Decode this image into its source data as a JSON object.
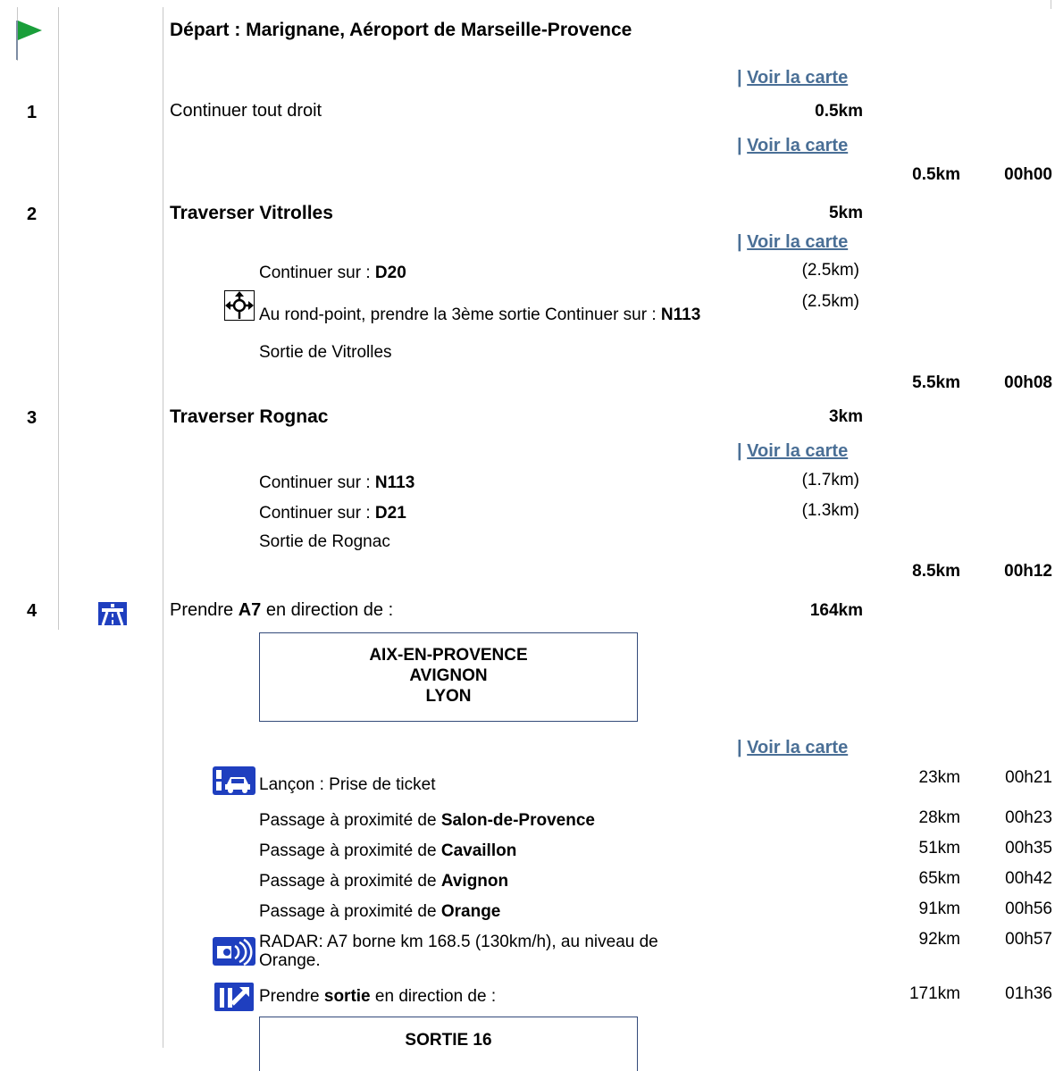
{
  "depart": {
    "label": "Départ : Marignane, Aéroport de Marseille-Provence"
  },
  "map_link": {
    "pipe": "|",
    "label": "Voir la carte"
  },
  "steps": [
    {
      "number": "1",
      "instruction": "Continuer tout droit",
      "distance": "0.5km",
      "cumulative_distance": "0.5km",
      "cumulative_time": "00h00"
    },
    {
      "number": "2",
      "title": "Traverser Vitrolles",
      "distance": "5km",
      "details": [
        {
          "prefix": "Continuer sur : ",
          "road": "D20",
          "distance": "(2.5km)"
        },
        {
          "prefix": "Au rond-point, prendre la 3ème sortie Continuer sur : ",
          "road": "N113",
          "distance": "(2.5km)"
        },
        {
          "text": "Sortie de Vitrolles"
        }
      ],
      "cumulative_distance": "5.5km",
      "cumulative_time": "00h08"
    },
    {
      "number": "3",
      "title": "Traverser Rognac",
      "distance": "3km",
      "details": [
        {
          "prefix": "Continuer sur : ",
          "road": "N113",
          "distance": "(1.7km)"
        },
        {
          "prefix": "Continuer sur : ",
          "road": "D21",
          "distance": "(1.3km)"
        },
        {
          "text": "Sortie de Rognac"
        }
      ],
      "cumulative_distance": "8.5km",
      "cumulative_time": "00h12"
    },
    {
      "number": "4",
      "prefix": "Prendre ",
      "road": "A7",
      "suffix": " en direction de :",
      "distance": "164km",
      "sign": [
        "AIX-EN-PROVENCE",
        "AVIGNON",
        "LYON"
      ],
      "events": [
        {
          "icon": "toll-ticket-icon",
          "text": "Lançon : Prise de ticket",
          "km": "23km",
          "time": "00h21"
        },
        {
          "prefix": "Passage à proximité de ",
          "place": "Salon-de-Provence",
          "km": "28km",
          "time": "00h23"
        },
        {
          "prefix": "Passage à proximité de ",
          "place": "Cavaillon",
          "km": "51km",
          "time": "00h35"
        },
        {
          "prefix": "Passage à proximité de ",
          "place": "Avignon",
          "km": "65km",
          "time": "00h42"
        },
        {
          "prefix": "Passage à proximité de ",
          "place": "Orange",
          "km": "91km",
          "time": "00h56"
        },
        {
          "icon": "radar-icon",
          "line1": "RADAR: A7 borne km 168.5 (130km/h), au niveau de",
          "line2": "Orange.",
          "km": "92km",
          "time": "00h57"
        },
        {
          "icon": "exit-icon",
          "prefix": "Prendre ",
          "bold": "sortie",
          "suffix": " en direction de :",
          "km": "171km",
          "time": "01h36"
        }
      ],
      "exit_sign": "SORTIE 16"
    }
  ],
  "colors": {
    "link": "#4a6f96",
    "flag": "#1a9e3a",
    "highway_icon": "#1f3fbf",
    "sign_border": "#334a7a"
  }
}
